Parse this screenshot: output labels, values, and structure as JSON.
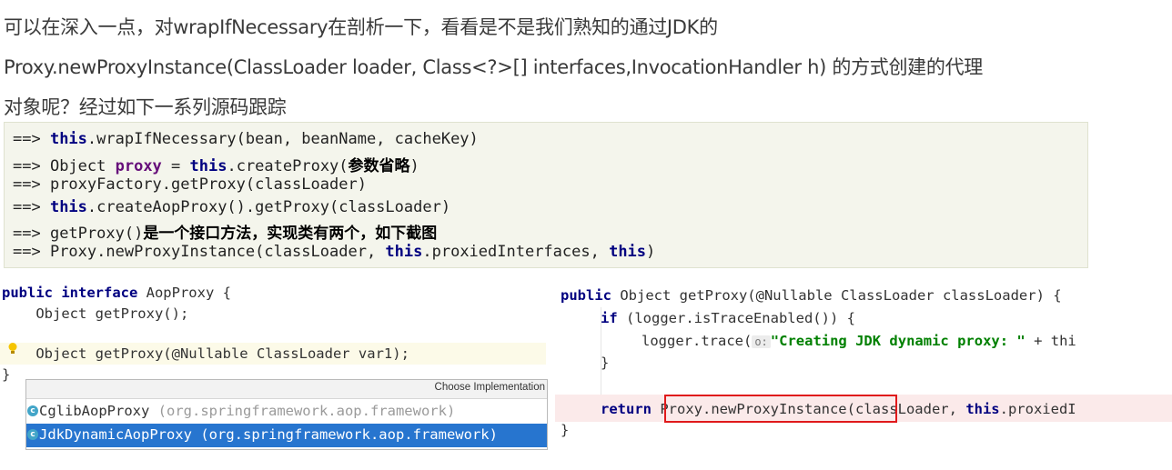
{
  "article": {
    "para_line1": "可以在深入一点，对wrapIfNecessary在剖析一下，看看是不是我们熟知的通过JDK的",
    "para_line2": "Proxy.newProxyInstance(ClassLoader loader, Class<?>[] interfaces,InvocationHandler h) 的方式创建的代理",
    "para_line3": "对象呢？经过如下一系列源码跟踪"
  },
  "trace": {
    "arrow": "==> ",
    "l1_kw": "this",
    "l1_rest": ".wrapIfNecessary(bean, beanName, cacheKey)",
    "l2_a": "Object ",
    "l2_kw1": "proxy",
    "l2_b": " = ",
    "l2_kw2": "this",
    "l2_c": ".createProxy(",
    "l2_cn": "参数省略",
    "l2_d": ")",
    "l3": "proxyFactory.getProxy(classLoader)",
    "l4_kw": "this",
    "l4_rest": ".createAopProxy().getProxy(classLoader)",
    "l5_a": "getProxy()",
    "l5_cn": "是一个接口方法，实现类有两个，如下截图",
    "l6_a": "Proxy.newProxyInstance(classLoader, ",
    "l6_kw1": "this",
    "l6_b": ".proxiedInterfaces, ",
    "l6_kw2": "this",
    "l6_c": ")"
  },
  "left_code": {
    "l1_kw": "public interface",
    "l1_rest": " AopProxy {",
    "l2": "    Object getProxy();",
    "l3": "    Object getProxy(@Nullable ClassLoader var1);",
    "l4": "}"
  },
  "chooser": {
    "title": "Choose Implementation",
    "items": [
      {
        "name": "CglibAopProxy",
        "pkg": "(org.springframework.aop.framework)"
      },
      {
        "name": "JdkDynamicAopProxy",
        "pkg": "(org.springframework.aop.framework)"
      }
    ],
    "selected_index": 1,
    "selected_color": "#2775cf"
  },
  "right_code": {
    "l1_kw": "public",
    "l1_rest": " Object getProxy(@Nullable ClassLoader classLoader) {",
    "l2_kw": "if",
    "l2_rest": " (logger.isTraceEnabled()) {",
    "l3_a": "logger.trace(",
    "l3_hint": "o:",
    "l3_str": "\"Creating JDK dynamic proxy: \"",
    "l3_b": " + thi",
    "l4": "}",
    "l5_kw": "return",
    "l5_box": "Proxy.newProxyInstance(",
    "l5_a": "classLoader, ",
    "l5_kw2": "this",
    "l5_b": ".proxiedI",
    "l6": "}"
  },
  "colors": {
    "highlight_box": "#e0191b",
    "keyword": "#000080",
    "string": "#008000"
  }
}
